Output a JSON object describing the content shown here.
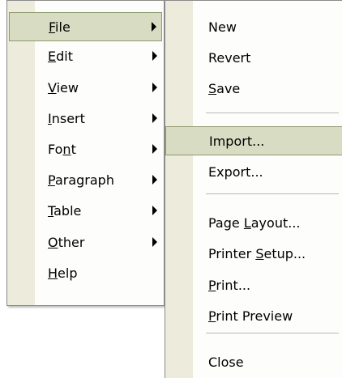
{
  "colors": {
    "menu_background": "#fdfdfb",
    "icon_strip": "#ecebdc",
    "highlight_background": "#d8dcc2",
    "highlight_border": "#8e9a6e",
    "border": "#8a8a8a",
    "separator": "#b9b9b5"
  },
  "main_menu": {
    "items": [
      {
        "pre": "",
        "key": "F",
        "post": "ile",
        "has_submenu": true,
        "selected": true
      },
      {
        "pre": "",
        "key": "E",
        "post": "dit",
        "has_submenu": true,
        "selected": false
      },
      {
        "pre": "",
        "key": "V",
        "post": "iew",
        "has_submenu": true,
        "selected": false
      },
      {
        "pre": "",
        "key": "I",
        "post": "nsert",
        "has_submenu": true,
        "selected": false
      },
      {
        "pre": "Fo",
        "key": "n",
        "post": "t",
        "has_submenu": true,
        "selected": false
      },
      {
        "pre": "",
        "key": "P",
        "post": "aragraph",
        "has_submenu": true,
        "selected": false
      },
      {
        "pre": "",
        "key": "T",
        "post": "able",
        "has_submenu": true,
        "selected": false
      },
      {
        "pre": "",
        "key": "O",
        "post": "ther",
        "has_submenu": true,
        "selected": false
      },
      {
        "pre": "",
        "key": "H",
        "post": "elp",
        "has_submenu": false,
        "selected": false
      }
    ]
  },
  "file_submenu": {
    "items": [
      {
        "pre": "New",
        "key": "",
        "post": "",
        "selected": false
      },
      {
        "pre": "Revert",
        "key": "",
        "post": "",
        "selected": false
      },
      {
        "pre": "",
        "key": "S",
        "post": "ave",
        "selected": false
      },
      {
        "pre": "Import...",
        "key": "",
        "post": "",
        "selected": true
      },
      {
        "pre": "Export...",
        "key": "",
        "post": "",
        "selected": false
      },
      {
        "pre": "Page ",
        "key": "L",
        "post": "ayout...",
        "selected": false
      },
      {
        "pre": "Printer ",
        "key": "S",
        "post": "etup...",
        "selected": false
      },
      {
        "pre": "",
        "key": "P",
        "post": "rint...",
        "selected": false
      },
      {
        "pre": "",
        "key": "P",
        "post": "rint Preview",
        "selected": false
      },
      {
        "pre": "Close",
        "key": "",
        "post": "",
        "selected": false
      }
    ]
  }
}
